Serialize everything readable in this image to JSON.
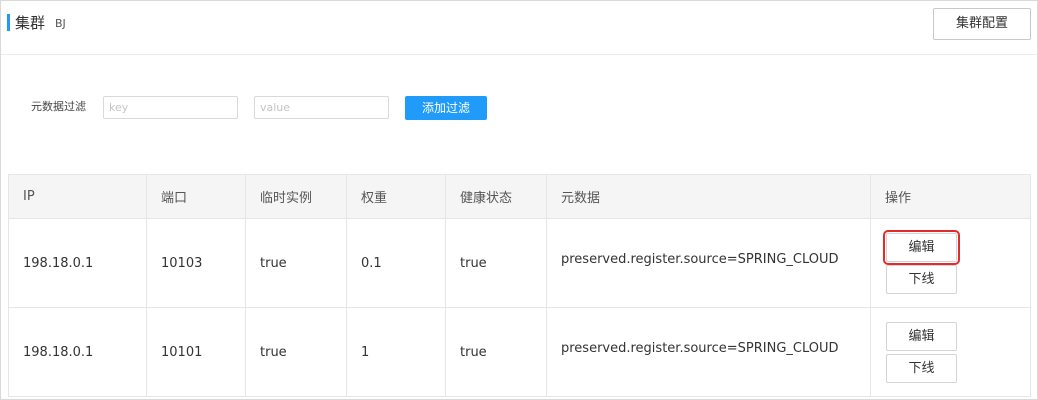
{
  "header": {
    "title": "集群",
    "cluster_name": "BJ",
    "config_button": "集群配置"
  },
  "filter": {
    "label": "元数据过滤",
    "key_placeholder": "key",
    "value_placeholder": "value",
    "add_button": "添加过滤"
  },
  "table": {
    "headers": [
      "IP",
      "端口",
      "临时实例",
      "权重",
      "健康状态",
      "元数据",
      "操作"
    ],
    "rows": [
      {
        "ip": "198.18.0.1",
        "port": "10103",
        "ephemeral": "true",
        "weight": "0.1",
        "healthy": "true",
        "metadata": "preserved.register.source=SPRING_CLOUD",
        "edit_label": "编辑",
        "offline_label": "下线"
      },
      {
        "ip": "198.18.0.1",
        "port": "10101",
        "ephemeral": "true",
        "weight": "1",
        "healthy": "true",
        "metadata": "preserved.register.source=SPRING_CLOUD",
        "edit_label": "编辑",
        "offline_label": "下线"
      }
    ]
  },
  "colors": {
    "accent": "#209bfa",
    "highlight": "#e32b2b",
    "header_bg": "#f5f5f5",
    "border": "#e6e6e6"
  }
}
